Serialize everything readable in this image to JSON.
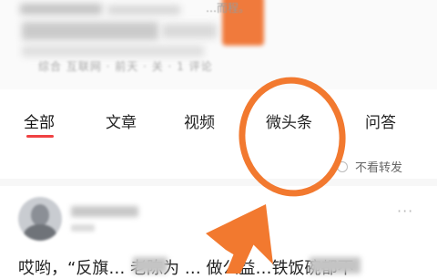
{
  "header": {
    "blurred_title_fragment": "…而程。",
    "blurred_meta": "综合 互联网 · 前天 · 关 · 1 评论"
  },
  "tabs": [
    {
      "label": "全部",
      "active": true
    },
    {
      "label": "文章",
      "active": false
    },
    {
      "label": "视频",
      "active": false
    },
    {
      "label": "微头条",
      "active": false
    },
    {
      "label": "问答",
      "active": false
    }
  ],
  "filter": {
    "label": "不看转发",
    "checked": false
  },
  "feed_item": {
    "more_label": "···",
    "body_text": "哎哟，“反旗… 老陈为 … 做公益…铁饭碗都不"
  },
  "colors": {
    "accent_red": "#f04142",
    "annotation_orange": "#f2792f"
  },
  "annotation": {
    "highlighted_tab": "微头条",
    "shape": "ellipse-with-arrow"
  }
}
